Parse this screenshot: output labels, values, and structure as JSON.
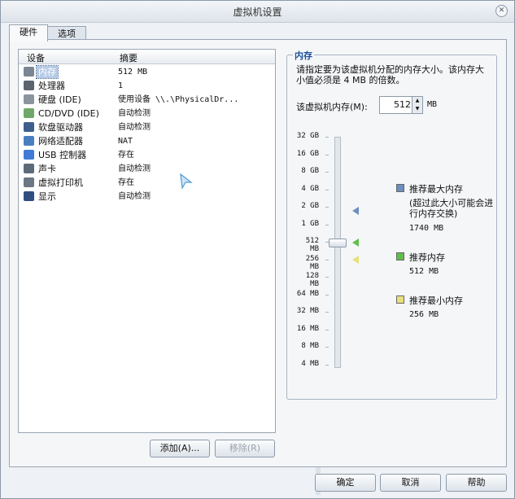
{
  "window": {
    "title": "虚拟机设置"
  },
  "tabs": [
    {
      "label": "硬件"
    },
    {
      "label": "选项"
    }
  ],
  "list": {
    "col_device": "设备",
    "col_summary": "摘要",
    "rows": [
      {
        "device": "内存",
        "summary": "512 MB",
        "icon": "memory-icon",
        "color": "#7a8694"
      },
      {
        "device": "处理器",
        "summary": "1",
        "icon": "cpu-icon",
        "color": "#5b6470"
      },
      {
        "device": "硬盘 (IDE)",
        "summary": "使用设备 \\\\.\\PhysicalDr...",
        "icon": "hard-disk-icon",
        "color": "#8a949f"
      },
      {
        "device": "CD/DVD (IDE)",
        "summary": "自动检测",
        "icon": "cd-icon",
        "color": "#6fa86a"
      },
      {
        "device": "软盘驱动器",
        "summary": "自动检测",
        "icon": "floppy-icon",
        "color": "#3e5f8e"
      },
      {
        "device": "网络适配器",
        "summary": "NAT",
        "icon": "network-icon",
        "color": "#4a7fbf"
      },
      {
        "device": "USB 控制器",
        "summary": "存在",
        "icon": "usb-icon",
        "color": "#3f7bd6"
      },
      {
        "device": "声卡",
        "summary": "自动检测",
        "icon": "speaker-icon",
        "color": "#5d6a78"
      },
      {
        "device": "虚拟打印机",
        "summary": "存在",
        "icon": "printer-icon",
        "color": "#6b7784"
      },
      {
        "device": "显示",
        "summary": "自动检测",
        "icon": "monitor-icon",
        "color": "#2f4f7f"
      }
    ]
  },
  "buttons": {
    "add": "添加(A)...",
    "remove": "移除(R)",
    "ok": "确定",
    "cancel": "取消",
    "help": "帮助"
  },
  "memory": {
    "group_title": "内存",
    "description": "请指定要为该虚拟机分配的内存大小。该内存大小值必须是 4 MB 的倍数。",
    "label": "该虚拟机内存(M):",
    "value": "512",
    "unit": "MB",
    "scale": [
      "32 GB",
      "16 GB",
      "8 GB",
      "4 GB",
      "2 GB",
      "1 GB",
      "512 MB",
      "256 MB",
      "128 MB",
      "64 MB",
      "32 MB",
      "16 MB",
      "8 MB",
      "4 MB"
    ],
    "legend": {
      "max_title": "推荐最大内存",
      "max_note": "(超过此大小可能会进行内存交换)",
      "max_value": "1740 MB",
      "rec_title": "推荐内存",
      "rec_value": "512 MB",
      "min_title": "推荐最小内存",
      "min_value": "256 MB"
    },
    "colors": {
      "max": "#6b8fbf",
      "rec": "#5fbf4a",
      "min": "#e8e07a"
    }
  }
}
